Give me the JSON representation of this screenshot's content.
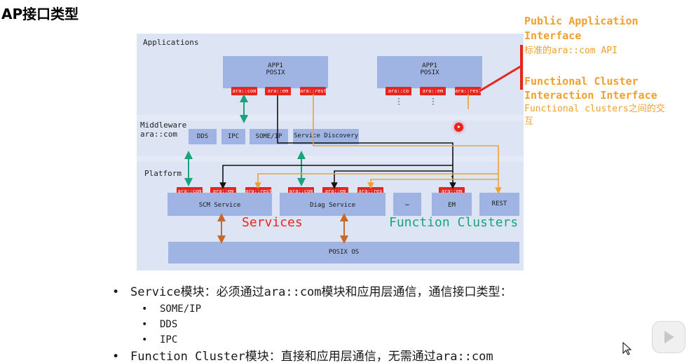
{
  "page": {
    "title": "AP接口类型"
  },
  "diagram": {
    "applications_label": "Applications",
    "app1_left": {
      "line1": "APP1",
      "line2": "POSIX"
    },
    "app1_right": {
      "line1": "APP1",
      "line2": "POSIX"
    },
    "app1_left_tags": [
      "ara::com",
      "ara::em",
      "ara::rest"
    ],
    "app1_right_tags": [
      "ara::co",
      "ara::em",
      "ara::rest"
    ],
    "middleware_label_1": "Middleware",
    "middleware_label_2": "ara::com",
    "middleware_boxes": [
      "DDS",
      "IPC",
      "SOME/IP",
      "Service Discovery"
    ],
    "platform_label": "Platform",
    "scm_tags": [
      "ara::com",
      "ara::em",
      "ara::rest"
    ],
    "diag_tags": [
      "ara::com",
      "ara::em",
      "ara::res"
    ],
    "em_tag": "ara::em",
    "scm_service": "SCM Service",
    "diag_service": "Diag Service",
    "ellipsis_box": "…",
    "em_box": "EM",
    "rest_box": "REST",
    "services_label": "Services",
    "function_clusters_label": "Function Clusters",
    "posix_os": "POSIX OS",
    "colors": {
      "red": "#e8241f",
      "green": "#1aa37a",
      "orange": "#f0a030",
      "black": "#111111",
      "brown": "#c8682a",
      "box": "#9fb4e2"
    }
  },
  "annotations": {
    "public_h1": "Public Application",
    "public_h2": "Interface",
    "public_desc": "标准的ara::com API",
    "fc_h1": "Functional Cluster",
    "fc_h2": "Interaction Interface",
    "fc_desc1": "Functional clusters之间的交",
    "fc_desc2": "互"
  },
  "bullets": {
    "service": "Service模块：必须通过ara::com模块和应用层通信，通信接口类型：",
    "sub": [
      "SOME/IP",
      "DDS",
      "IPC"
    ],
    "function_cluster": "Function Cluster模块：直接和应用层通信，无需通过ara::com"
  }
}
